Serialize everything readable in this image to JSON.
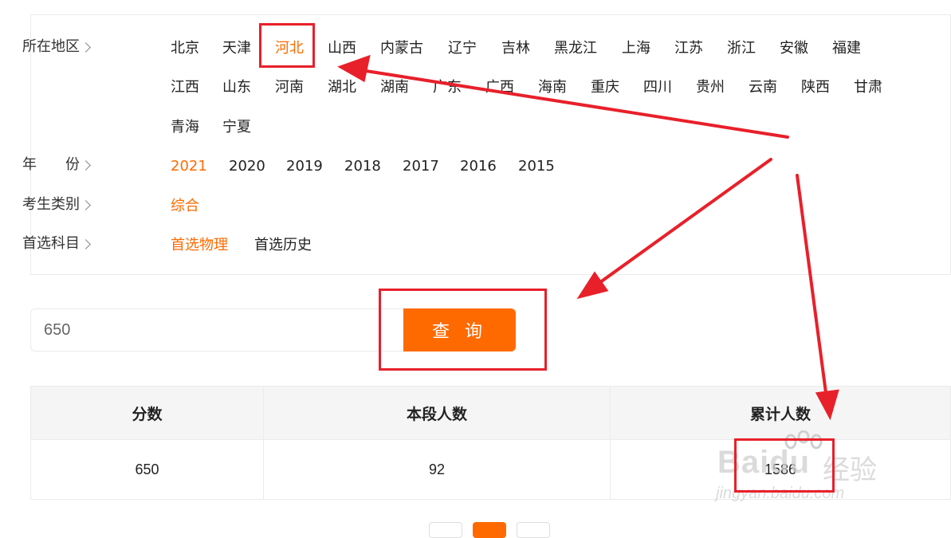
{
  "filters": {
    "region": {
      "label": "所在地区",
      "options": [
        "北京",
        "天津",
        "河北",
        "山西",
        "内蒙古",
        "辽宁",
        "吉林",
        "黑龙江",
        "上海",
        "江苏",
        "浙江",
        "安徽",
        "福建",
        "江西",
        "山东",
        "河南",
        "湖北",
        "湖南",
        "广东",
        "广西",
        "海南",
        "重庆",
        "四川",
        "贵州",
        "云南",
        "陕西",
        "甘肃",
        "青海",
        "宁夏"
      ],
      "selected": "河北"
    },
    "year": {
      "label": "年　　份",
      "options": [
        "2021",
        "2020",
        "2019",
        "2018",
        "2017",
        "2016",
        "2015"
      ],
      "selected": "2021"
    },
    "category": {
      "label": "考生类别",
      "options": [
        "综合"
      ],
      "selected": "综合"
    },
    "subject": {
      "label": "首选科目",
      "options": [
        "首选物理",
        "首选历史"
      ],
      "selected": "首选物理"
    }
  },
  "search": {
    "value": "650",
    "button_label": "查 询"
  },
  "table": {
    "headers": [
      "分数",
      "本段人数",
      "累计人数"
    ],
    "rows": [
      [
        "650",
        "92",
        "1586"
      ]
    ]
  },
  "watermark": {
    "brand": "Baidu",
    "brand_cn": "经验",
    "url": "jingyan.baidu.com"
  },
  "colors": {
    "accent": "#ff6a00",
    "annotation": "#e8202a"
  }
}
